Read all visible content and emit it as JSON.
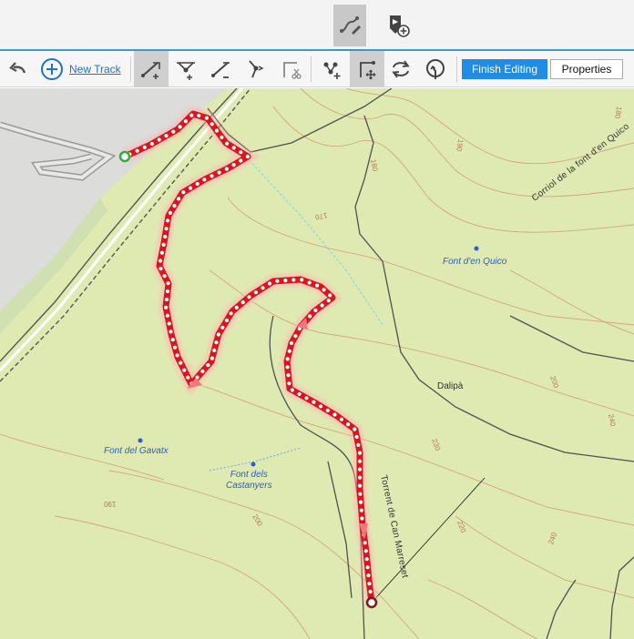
{
  "top_bar": {
    "draw_track_tool": "draw-track-icon",
    "add_waypoint_tool": "waypoint-add-icon"
  },
  "toolbar": {
    "new_track_label": "New Track",
    "finish_editing_label": "Finish Editing",
    "properties_label": "Properties"
  },
  "map": {
    "places": [
      {
        "id": "font-den-quico",
        "label": "Font d'en Quico"
      },
      {
        "id": "font-del-gavatx",
        "label": "Font del Gavatx"
      },
      {
        "id": "font-dels-castanyers",
        "label": "Font dels\nCastanyers"
      }
    ],
    "areas": [
      {
        "id": "dalipa",
        "label": "Dalipà"
      }
    ],
    "paths": [
      {
        "id": "corriol",
        "label": "Corriol de la font d'en Quico"
      },
      {
        "id": "torrent",
        "label": "Torrent de Can Marreset"
      }
    ],
    "contours": [
      "180",
      "170",
      "190",
      "180",
      "200",
      "220",
      "240",
      "230",
      "190",
      "200",
      "240"
    ]
  },
  "colors": {
    "accent": "#1f8ce6",
    "track": "#d9151e",
    "map_green": "#dfeab3",
    "contour": "#d4a57c"
  }
}
